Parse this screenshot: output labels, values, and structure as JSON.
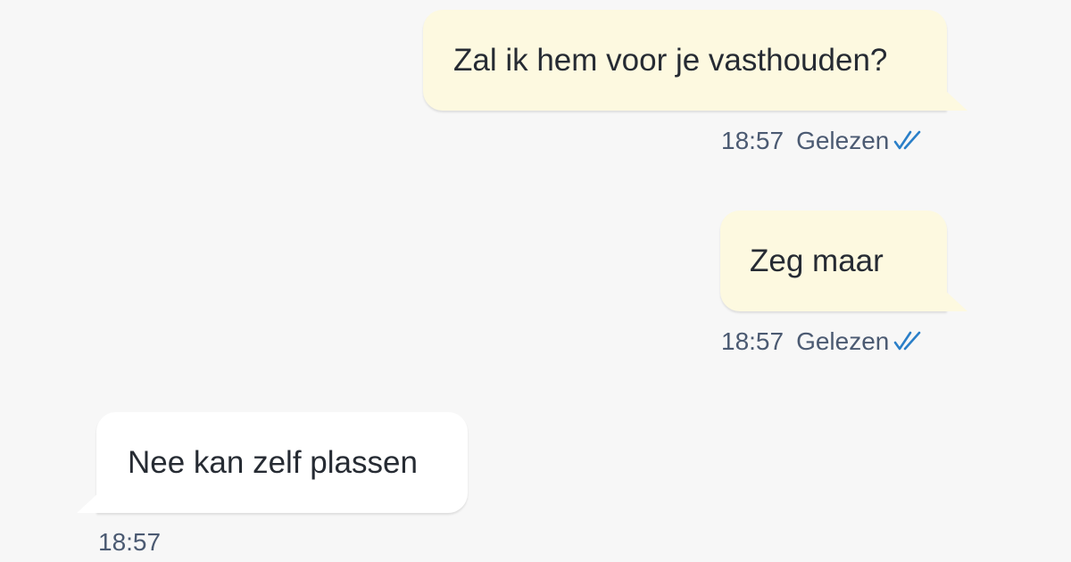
{
  "conversation": {
    "messages": [
      {
        "direction": "outgoing",
        "text": "Zal ik hem voor je vasthouden?",
        "time": "18:57",
        "status": "Gelezen",
        "status_icon": "double-check-icon"
      },
      {
        "direction": "outgoing",
        "text": "Zeg maar",
        "time": "18:57",
        "status": "Gelezen",
        "status_icon": "double-check-icon"
      },
      {
        "direction": "incoming",
        "text": "Nee kan zelf plassen",
        "time": "18:57"
      }
    ]
  },
  "colors": {
    "background": "#f7f7f7",
    "outgoing_bubble": "#fdf9e0",
    "incoming_bubble": "#ffffff",
    "text": "#262b33",
    "meta_text": "#4b5a72",
    "read_check": "#2a7fc8"
  }
}
